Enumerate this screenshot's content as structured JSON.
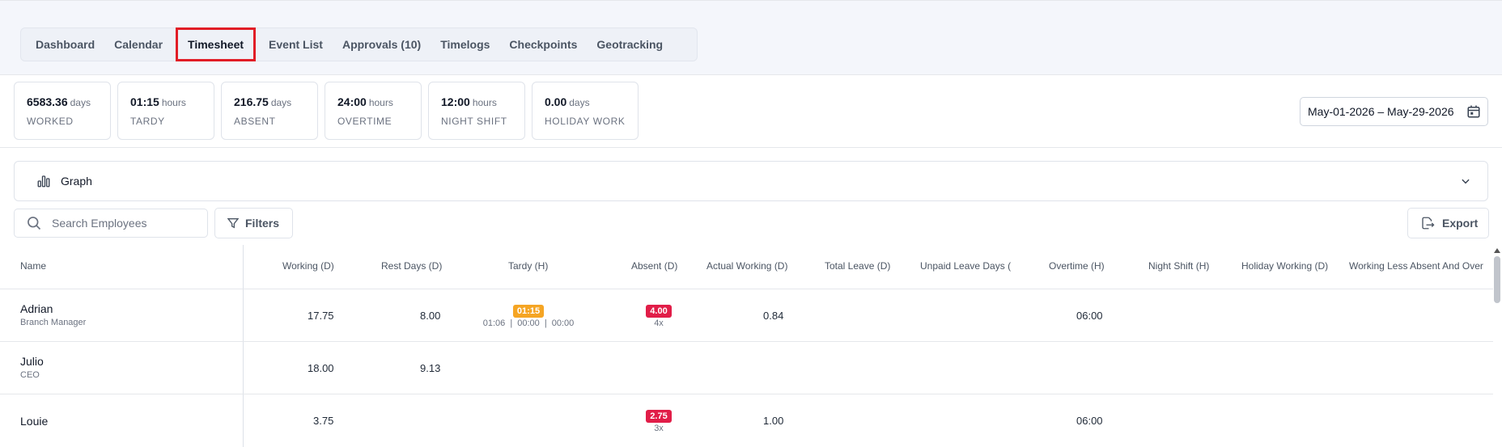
{
  "nav": {
    "tabs": [
      {
        "label": "Dashboard"
      },
      {
        "label": "Calendar"
      },
      {
        "label": "Timesheet",
        "active": true
      },
      {
        "label": "Event List"
      },
      {
        "label": "Approvals (10)"
      },
      {
        "label": "Timelogs"
      },
      {
        "label": "Checkpoints"
      },
      {
        "label": "Geotracking"
      }
    ]
  },
  "stats": [
    {
      "value": "6583.36",
      "unit": "days",
      "label": "WORKED"
    },
    {
      "value": "01:15",
      "unit": "hours",
      "label": "TARDY"
    },
    {
      "value": "216.75",
      "unit": "days",
      "label": "ABSENT"
    },
    {
      "value": "24:00",
      "unit": "hours",
      "label": "OVERTIME"
    },
    {
      "value": "12:00",
      "unit": "hours",
      "label": "NIGHT SHIFT"
    },
    {
      "value": "0.00",
      "unit": "days",
      "label": "HOLIDAY WORK"
    }
  ],
  "date_range": "May-01-2026 – May-29-2026",
  "graph": {
    "label": "Graph"
  },
  "toolbar": {
    "search_placeholder": "Search Employees",
    "filters_label": "Filters",
    "export_label": "Export"
  },
  "table": {
    "columns": [
      "Name",
      "Working (D)",
      "Rest Days (D)",
      "Tardy (H)",
      "Absent (D)",
      "Actual Working (D)",
      "Total Leave (D)",
      "Unpaid Leave Days (",
      "Overtime (H)",
      "Night Shift (H)",
      "Holiday Working (D)",
      "Working Less Absent And Over"
    ],
    "rows": [
      {
        "name": "Adrian",
        "role": "Branch Manager",
        "working": "17.75",
        "rest": "8.00",
        "tardy_badge": "01:15",
        "tardy_sub": [
          "01:06",
          "00:00",
          "00:00"
        ],
        "absent_badge": "4.00",
        "absent_sub": "4x",
        "actual": "0.84",
        "overtime": "06:00"
      },
      {
        "name": "Julio",
        "role": "CEO",
        "working": "18.00",
        "rest": "9.13"
      },
      {
        "name": "Louie",
        "role": "",
        "working": "3.75",
        "absent_badge": "2.75",
        "absent_sub": "3x",
        "actual": "1.00",
        "overtime": "06:00"
      }
    ]
  },
  "colors": {
    "accent_red": "#e11d26",
    "tardy_badge": "#f5a524",
    "absent_badge": "#e11d48"
  }
}
